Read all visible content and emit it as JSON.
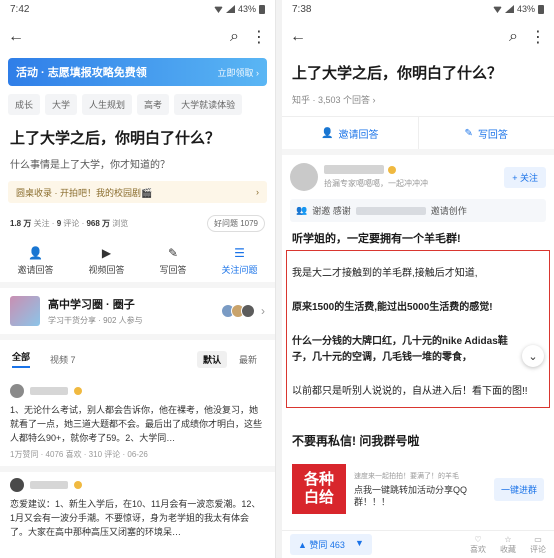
{
  "left": {
    "status": {
      "time": "7:42",
      "battery": "43%"
    },
    "banner": {
      "label": "活动 · 志愿填报攻略免费领",
      "claim": "立即领取 ›"
    },
    "tags": [
      "成长",
      "大学",
      "人生规划",
      "高考",
      "大学就读体验"
    ],
    "title": "上了大学之后，你明白了什么？",
    "desc": "什么事情是上了大学，你才知道的？",
    "roundtable": "圆桌收录 · 开拍吧！我的校园剧🎬",
    "stats": {
      "follow_count": "1.8 万",
      "follow_label": "关注",
      "comment_count": "9",
      "comment_label": "评论",
      "view_count": "968 万",
      "view_label": "浏览",
      "goodq": "好问题 1079"
    },
    "actions": [
      {
        "icon": "👤",
        "label": "邀请回答"
      },
      {
        "icon": "▶",
        "label": "视频回答"
      },
      {
        "icon": "✎",
        "label": "写回答"
      },
      {
        "icon": "☰",
        "label": "关注问题"
      }
    ],
    "circle": {
      "name": "高中学习圈 · 圈子",
      "sub": "学习干货分享 · 902 人参与"
    },
    "sort": {
      "all": "全部",
      "video": "视频 7",
      "default": "默认",
      "latest": "最新"
    },
    "answers": [
      {
        "text": "1、无论什么考试，别人都会告诉你，他在裸考，他没复习，她就看了一点，她三道大题都不会。最后出了成绩你才明白，这些人都特么90+，就你考了59。2、大学同…",
        "meta": "1万赞同 · 4076 喜欢 · 310 评论 · 06-26"
      },
      {
        "text": "恋爱建议：1、新生入学后，在10、11月会有一波恋爱潮。12、1月又会有一波分手潮。不要惊讶，身为老学姐的我太有体会了。大家在高中那种高压又闭塞的环境呆…",
        "meta": ""
      }
    ]
  },
  "right": {
    "status": {
      "time": "7:38",
      "battery": "43%"
    },
    "title": "上了大学之后，你明白了什么？",
    "meta": "知乎 · 3,503 个回答 ›",
    "invite_btn": "邀请回答",
    "write_btn": "写回答",
    "author_sub": "拾漏专家噶噶噶，一起冲冲冲",
    "follow": "+ 关注",
    "invite_line": {
      "prefix": "谢邀 感谢",
      "suffix": "邀请创作"
    },
    "headline": "听学姐的，一定要拥有一个羊毛群!",
    "paras": [
      "我是大二才接触到的羊毛群,接触后才知道,",
      "原来1500的生活费,能过出5000生活费的感觉!",
      "什么一分钱的大牌口红，几十元的nike Adidas鞋子，几十元的空调，几毛钱一堆的零食，",
      "以前都只是听别人说说的，自从进入后！看下面的图!!"
    ],
    "group_title": "不要再私信! 问我群号啦",
    "promo": {
      "img": "各种\n白给",
      "tag": "速度来一起拍拍！要满了！的羊毛",
      "desc": "点我一键跳转加活动分享QQ群！！！",
      "join": "一键进群"
    },
    "vote": {
      "up": "▲ 赞同 463",
      "down": "▼"
    },
    "bottom_icons": [
      "喜欢",
      "收藏",
      "评论"
    ]
  }
}
